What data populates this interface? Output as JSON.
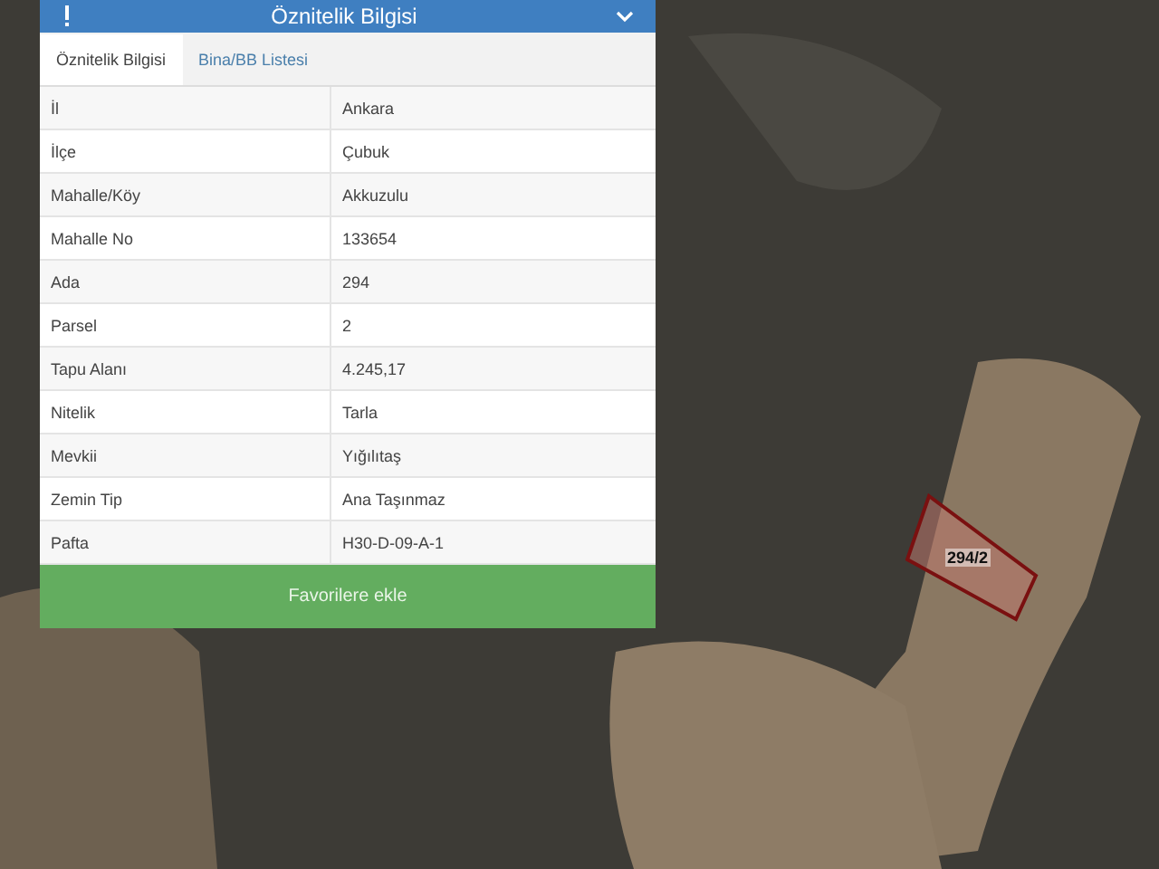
{
  "map": {
    "parcel_label": "294/2"
  },
  "panel": {
    "title": "Öznitelik Bilgisi",
    "tabs": [
      {
        "label": "Öznitelik Bilgisi",
        "selected": true
      },
      {
        "label": "Bina/BB Listesi",
        "selected": false
      }
    ],
    "rows": [
      {
        "label": "İl",
        "value": "Ankara"
      },
      {
        "label": "İlçe",
        "value": "Çubuk"
      },
      {
        "label": "Mahalle/Köy",
        "value": "Akkuzulu"
      },
      {
        "label": "Mahalle No",
        "value": "133654"
      },
      {
        "label": "Ada",
        "value": "294"
      },
      {
        "label": "Parsel",
        "value": "2"
      },
      {
        "label": "Tapu Alanı",
        "value": "4.245,17"
      },
      {
        "label": "Nitelik",
        "value": "Tarla"
      },
      {
        "label": "Mevkii",
        "value": "Yığılıtaş"
      },
      {
        "label": "Zemin Tip",
        "value": "Ana Taşınmaz"
      },
      {
        "label": "Pafta",
        "value": "H30-D-09-A-1"
      }
    ],
    "button": "Favorilere ekle"
  }
}
